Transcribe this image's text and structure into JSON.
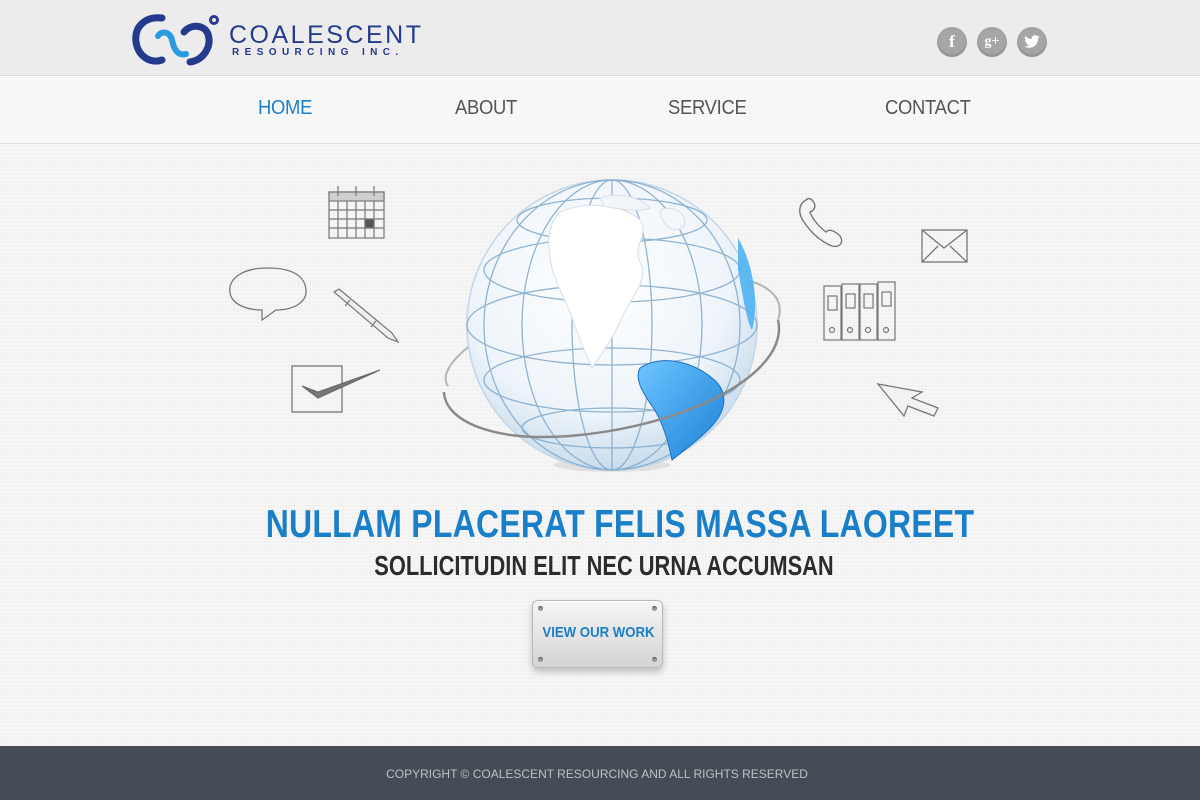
{
  "brand": {
    "name": "COALESCENT",
    "tagline": "RESOURCING INC.",
    "accent": "#1a7fc9",
    "logo_color": "#243a8c"
  },
  "social": [
    {
      "name": "facebook",
      "glyph": "f"
    },
    {
      "name": "google-plus",
      "glyph": "g+"
    },
    {
      "name": "twitter",
      "glyph": "twitter-bird"
    }
  ],
  "nav": {
    "items": [
      {
        "label": "HOME",
        "active": true
      },
      {
        "label": "ABOUT",
        "active": false
      },
      {
        "label": "SERVICE",
        "active": false
      },
      {
        "label": "CONTACT",
        "active": false
      }
    ]
  },
  "hero": {
    "icons": [
      "calendar-icon",
      "speech-bubble-icon",
      "pen-icon",
      "checkbox-icon",
      "globe-icon",
      "phone-icon",
      "envelope-icon",
      "binders-icon",
      "cursor-arrow-icon"
    ],
    "headline": "NULLAM PLACERAT FELIS MASSA LAOREET",
    "subline": "SOLLICITUDIN ELIT NEC URNA ACCUMSAN",
    "cta_label": "VIEW OUR WORK"
  },
  "footer": {
    "copyright": "COPYRIGHT © COALESCENT RESOURCING AND ALL RIGHTS RESERVED",
    "background": "#454c55"
  }
}
